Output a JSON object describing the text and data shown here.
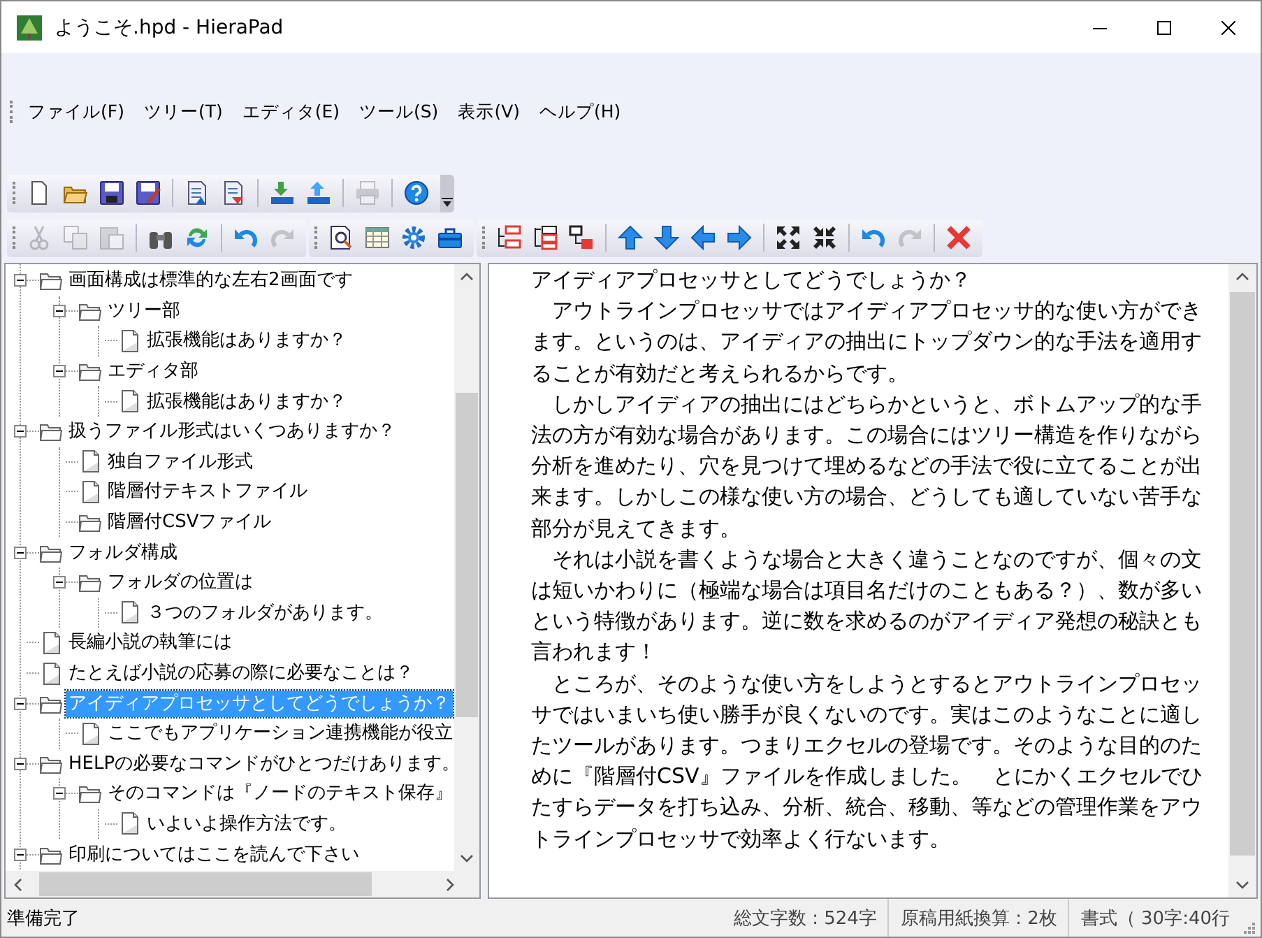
{
  "window": {
    "title": "ようこそ.hpd - HieraPad"
  },
  "menu": [
    "ファイル(F)",
    "ツリー(T)",
    "エディタ(E)",
    "ツール(S)",
    "表示(V)",
    "ヘルプ(H)"
  ],
  "toolbars": [
    {
      "groups": [
        [
          {
            "disabled": false
          },
          {
            "disabled": false
          },
          {
            "disabled": false
          },
          {
            "disabled": false
          }
        ],
        [
          {
            "disabled": false
          },
          {
            "disabled": false
          }
        ],
        [
          {
            "disabled": false
          },
          {
            "disabled": false
          }
        ],
        [
          {
            "disabled": true
          }
        ],
        [
          {
            "disabled": false
          }
        ]
      ]
    },
    {
      "groups": [
        [
          {
            "disabled": true
          },
          {
            "disabled": true
          },
          {
            "disabled": true
          }
        ],
        [
          {
            "disabled": false
          },
          {
            "disabled": false
          }
        ],
        [
          {
            "disabled": false
          },
          {
            "disabled": true
          }
        ]
      ]
    },
    {
      "groups": [
        [
          {
            "disabled": false
          },
          {
            "disabled": false
          },
          {
            "disabled": false
          },
          {
            "disabled": false
          }
        ]
      ]
    },
    {
      "groups": [
        [
          {
            "disabled": false
          },
          {
            "disabled": false
          },
          {
            "disabled": false
          }
        ],
        [
          {
            "disabled": false
          },
          {
            "disabled": false
          },
          {
            "disabled": false
          },
          {
            "disabled": false
          }
        ],
        [
          {
            "disabled": false
          },
          {
            "disabled": false
          }
        ],
        [
          {
            "disabled": false
          },
          {
            "disabled": true
          }
        ],
        [
          {
            "disabled": false
          }
        ]
      ]
    }
  ],
  "tree": [
    {
      "kind": "folder",
      "label": "画面構成は標準的な左右2画面です",
      "expanded": true,
      "selected": false,
      "children": [
        {
          "kind": "folder",
          "label": "ツリー部",
          "expanded": true,
          "selected": false,
          "children": [
            {
              "kind": "file",
              "label": "拡張機能はありますか？",
              "selected": false
            }
          ]
        },
        {
          "kind": "folder",
          "label": "エディタ部",
          "expanded": true,
          "selected": false,
          "children": [
            {
              "kind": "file",
              "label": "拡張機能はありますか？",
              "selected": false
            }
          ]
        }
      ]
    },
    {
      "kind": "folder",
      "label": "扱うファイル形式はいくつありますか？",
      "expanded": true,
      "selected": false,
      "children": [
        {
          "kind": "file",
          "label": "独自ファイル形式",
          "selected": false
        },
        {
          "kind": "file",
          "label": "階層付テキストファイル",
          "selected": false
        },
        {
          "kind": "folder",
          "label": "階層付CSVファイル",
          "selected": false
        }
      ]
    },
    {
      "kind": "folder",
      "label": "フォルダ構成",
      "expanded": true,
      "selected": false,
      "children": [
        {
          "kind": "folder",
          "label": "フォルダの位置は",
          "expanded": true,
          "selected": false,
          "children": [
            {
              "kind": "file",
              "label": "３つのフォルダがあります。",
              "selected": false
            }
          ]
        }
      ]
    },
    {
      "kind": "file",
      "label": "長編小説の執筆には",
      "selected": false
    },
    {
      "kind": "file",
      "label": "たとえば小説の応募の際に必要なことは？",
      "selected": false
    },
    {
      "kind": "folder",
      "label": "アイディアプロセッサとしてどうでしょうか？",
      "expanded": true,
      "selected": true,
      "children": [
        {
          "kind": "file",
          "label": "ここでもアプリケーション連携機能が役立",
          "selected": false
        }
      ]
    },
    {
      "kind": "folder",
      "label": "HELPの必要なコマンドがひとつだけあります。",
      "expanded": true,
      "selected": false,
      "children": [
        {
          "kind": "folder",
          "label": "そのコマンドは『ノードのテキスト保存』",
          "expanded": true,
          "selected": false,
          "children": [
            {
              "kind": "file",
              "label": "いよいよ操作方法です。",
              "selected": false
            }
          ]
        }
      ]
    },
    {
      "kind": "folder",
      "label": "印刷についてはここを読んで下さい",
      "expanded": true,
      "selected": false
    }
  ],
  "editor": {
    "paragraphs": [
      "アイディアプロセッサとしてどうでしょうか？",
      "　アウトラインプロセッサではアイディアプロセッサ的な使い方ができます。というのは、アイディアの抽出にトップダウン的な手法を適用することが有効だと考えられるからです。",
      "　しかしアイディアの抽出にはどちらかというと、ボトムアップ的な手法の方が有効な場合があります。この場合にはツリー構造を作りながら分析を進めたり、穴を見つけて埋めるなどの手法で役に立てることが出来ます。しかしこの様な使い方の場合、どうしても適していない苦手な部分が見えてきます。",
      "　それは小説を書くような場合と大きく違うことなのですが、個々の文は短いかわりに（極端な場合は項目名だけのこともある？）、数が多いという特徴があります。逆に数を求めるのがアイディア発想の秘訣とも言われます！",
      "　ところが、そのような使い方をしようとするとアウトラインプロセッサではいまいち使い勝手が良くないのです。実はこのようなことに適したツールがあります。つまりエクセルの登場です。そのような目的のために『階層付CSV』ファイルを作成しました。　とにかくエクセルでひたすらデータを打ち込み、分析、統合、移動、等などの管理作業をアウトラインプロセッサで効率よく行ないます。"
    ]
  },
  "status_bar": {
    "message": "準備完了",
    "char_count": "総文字数 : 524字",
    "manuscript": "原稿用紙換算 : 2枚",
    "format": "書式（ 30字:40行"
  }
}
